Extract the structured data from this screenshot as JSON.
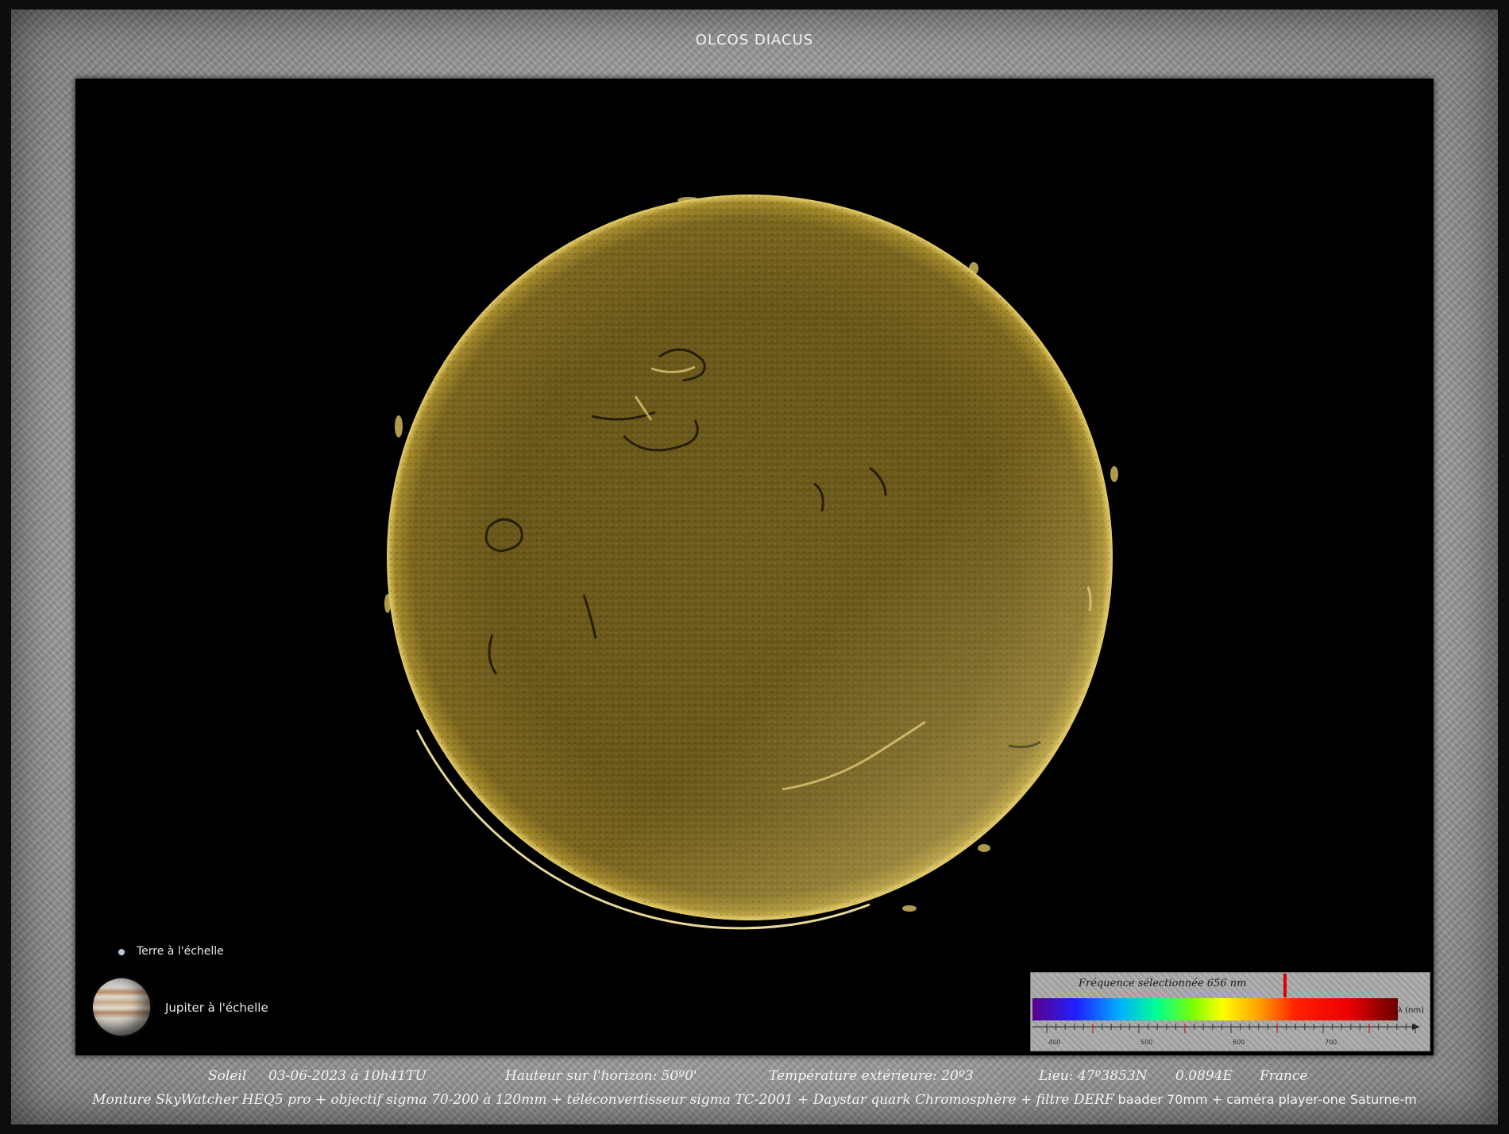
{
  "title": "OLCOS DIACUS",
  "scale_labels": {
    "earth": "Terre à l'échelle",
    "jupiter": "Jupiter à l'échelle"
  },
  "spectrum": {
    "label": "Fréquence sélectionnée 656 nm",
    "axis_unit": "λ (nm)",
    "tick_labels": [
      "400",
      "500",
      "600",
      "700"
    ],
    "selected_nm": 656
  },
  "caption": {
    "object": "Soleil",
    "datetime": "03-06-2023  à  10h41TU",
    "altitude": "Hauteur sur l'horizon: 50º0'",
    "temperature": "Température extérieure: 20º3",
    "location_lat": "Lieu: 47º3853N",
    "location_lon": "0.0894E",
    "country": "France",
    "equipment_italic": "Monture SkyWatcher HEQ5 pro +  objectif  sigma  70-200 à 120mm  +  téléconvertisseur sigma TC-2001 +  Daystar quark Chromosphère  +  filtre DERF",
    "equipment_upright": " baader 70mm +  caméra player-one Saturne-m"
  },
  "colors": {
    "sun_base": "#6b5a1c",
    "sun_limb": "#f5de7a",
    "background": "#000000",
    "frame": "#a5a5a5"
  }
}
